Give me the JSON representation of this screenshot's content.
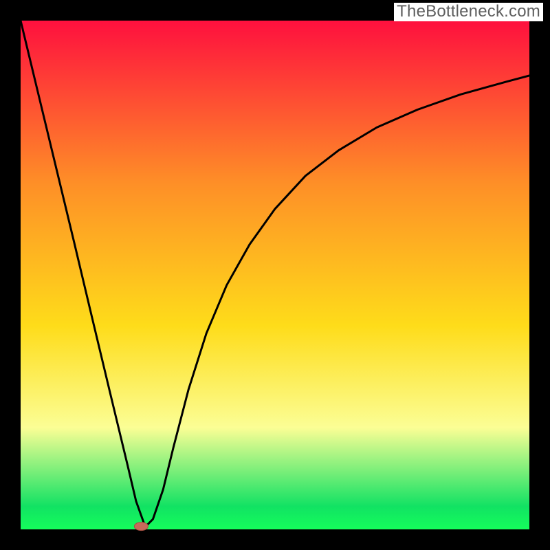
{
  "watermark": "TheBottleneck.com",
  "colors": {
    "frame": "#000000",
    "curve": "#000000",
    "marker_fill": "#c86a5a",
    "marker_stroke": "#a54f42",
    "gradient_top": "#fe103e",
    "gradient_mid1": "#fe8f27",
    "gradient_mid2": "#fedc1a",
    "gradient_band": "#fbfe95",
    "gradient_green": "#11e263",
    "gradient_bottom": "#15fe5b"
  },
  "chart_data": {
    "type": "line",
    "title": "",
    "xlabel": "",
    "ylabel": "",
    "note": "Axes unlabeled; values normalized from pixel positions (x,y in 0..1 of plot area, y=0 at bottom).",
    "xlim": [
      0,
      1
    ],
    "ylim": [
      0,
      1
    ],
    "series": [
      {
        "name": "curve",
        "x": [
          0.0,
          0.035,
          0.07,
          0.105,
          0.14,
          0.175,
          0.21,
          0.227,
          0.245,
          0.26,
          0.28,
          0.3,
          0.33,
          0.365,
          0.405,
          0.45,
          0.5,
          0.56,
          0.625,
          0.7,
          0.78,
          0.865,
          0.955,
          1.0
        ],
        "y": [
          1.0,
          0.855,
          0.71,
          0.565,
          0.418,
          0.272,
          0.127,
          0.055,
          0.005,
          0.02,
          0.078,
          0.16,
          0.275,
          0.385,
          0.48,
          0.56,
          0.63,
          0.695,
          0.745,
          0.79,
          0.825,
          0.855,
          0.88,
          0.892
        ]
      }
    ],
    "marker": {
      "x": 0.237,
      "y": 0.006
    },
    "gradient_stops_y_fraction_from_top": [
      {
        "offset": 0.0,
        "color": "#fe103e"
      },
      {
        "offset": 0.32,
        "color": "#fe8f27"
      },
      {
        "offset": 0.6,
        "color": "#fedc1a"
      },
      {
        "offset": 0.8,
        "color": "#fbfe95"
      },
      {
        "offset": 0.955,
        "color": "#11e263"
      },
      {
        "offset": 1.0,
        "color": "#15fe5b"
      }
    ]
  }
}
